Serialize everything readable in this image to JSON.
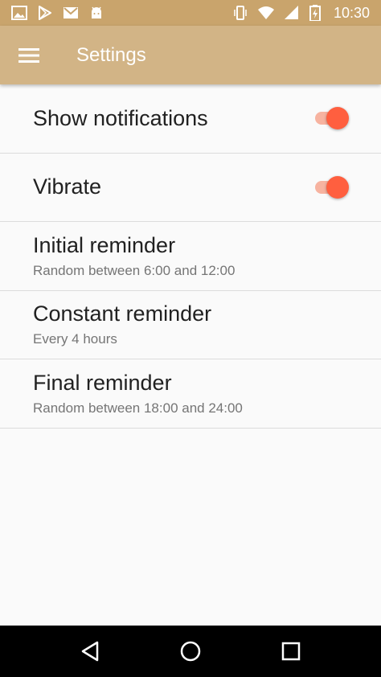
{
  "status_bar": {
    "time": "10:30",
    "left_icons": [
      "image-icon",
      "play-store-icon",
      "gmail-icon",
      "android-icon"
    ],
    "right_icons": [
      "vibrate-icon",
      "wifi-icon",
      "signal-icon",
      "battery-icon"
    ]
  },
  "app_bar": {
    "title": "Settings",
    "menu_icon": "hamburger-menu-icon",
    "background": "#d2b486"
  },
  "settings": [
    {
      "title": "Show notifications",
      "subtitle": "",
      "toggle": true
    },
    {
      "title": "Vibrate",
      "subtitle": "",
      "toggle": true
    },
    {
      "title": "Initial reminder",
      "subtitle": "Random between 6:00 and 12:00"
    },
    {
      "title": "Constant reminder",
      "subtitle": "Every 4 hours"
    },
    {
      "title": "Final reminder",
      "subtitle": "Random between 18:00 and 24:00"
    }
  ],
  "colors": {
    "accent": "#ff5f3f",
    "status_bar": "#c9a46c"
  },
  "nav_bar": {
    "buttons": [
      "back-icon",
      "home-icon",
      "recents-icon"
    ]
  }
}
